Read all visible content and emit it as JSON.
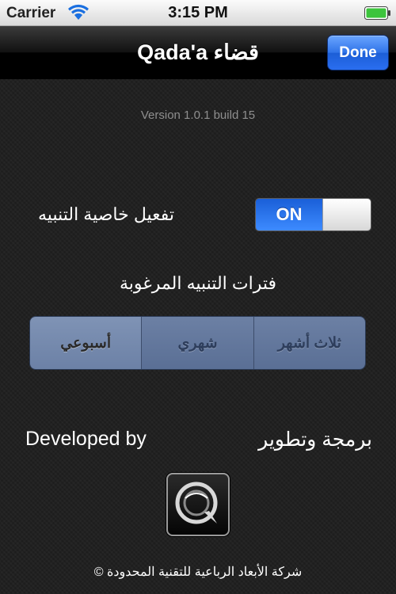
{
  "status_bar": {
    "carrier": "Carrier",
    "time": "3:15 PM",
    "wifi_icon": "wifi-icon",
    "battery_icon": "battery-icon"
  },
  "nav": {
    "title": "Qada'a قضاء",
    "done_label": "Done"
  },
  "version_text": "Version 1.0.1 build 15",
  "alert_setting": {
    "label": "تفعيل خاصية التنبيه",
    "toggle_label": "ON",
    "toggle_state": true
  },
  "periods": {
    "label": "فترات التنبيه المرغوبة",
    "options": [
      "أسبوعي",
      "شهري",
      "ثلاث أشهر"
    ],
    "selected": "أسبوعي"
  },
  "developer": {
    "label_en": "Developed by",
    "label_ar": "برمجة وتطوير"
  },
  "footer": {
    "copyright": "شركة الأبعاد الرباعية للتقنية المحدودة ©"
  },
  "colors": {
    "accent": "#2f73e8",
    "background": "#212121"
  }
}
